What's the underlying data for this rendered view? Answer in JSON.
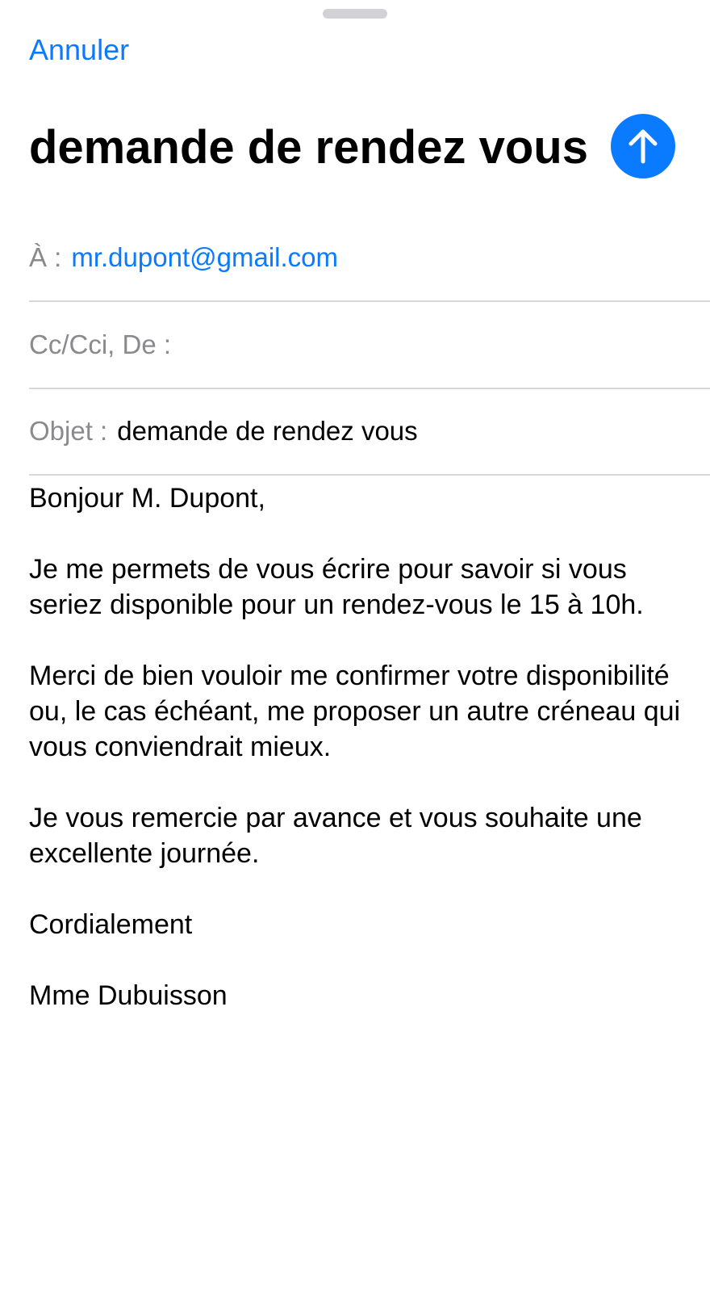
{
  "compose": {
    "cancel_label": "Annuler",
    "title": "demande de rendez vous",
    "send_icon": "arrow-up-icon",
    "accent_color": "#0a7aff"
  },
  "fields": {
    "to_label": "À :",
    "to_value": "mr.dupont@gmail.com",
    "cc_label": "Cc/Cci, De :",
    "subject_label": "Objet :",
    "subject_value": "demande de rendez vous"
  },
  "body": {
    "paragraphs": [
      "Bonjour M. Dupont,",
      "Je me permets de vous écrire pour savoir si vous seriez disponible pour un rendez-vous le 15 à 10h.",
      "Merci de bien vouloir me confirmer votre disponibilité ou, le cas échéant, me proposer un autre créneau qui vous conviendrait mieux.",
      "Je vous remercie par avance et vous souhaite une excellente journée.",
      "Cordialement",
      "Mme Dubuisson"
    ]
  }
}
